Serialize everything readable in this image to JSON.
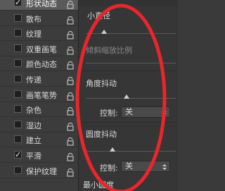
{
  "sidebar": {
    "items": [
      {
        "label": "形状动态",
        "checked": true,
        "active": true,
        "locked": true
      },
      {
        "label": "散布",
        "checked": false,
        "locked": true
      },
      {
        "label": "纹理",
        "checked": false,
        "locked": true
      },
      {
        "label": "双重画笔",
        "checked": false,
        "locked": true
      },
      {
        "label": "颜色动态",
        "checked": false,
        "locked": true
      },
      {
        "label": "传递",
        "checked": false,
        "locked": true
      },
      {
        "label": "画笔笔势",
        "checked": false,
        "locked": true
      },
      {
        "label": "杂色",
        "checked": false,
        "locked": true
      },
      {
        "label": "湿边",
        "checked": false,
        "locked": true
      },
      {
        "label": "建立",
        "checked": false,
        "locked": true
      },
      {
        "label": "平滑",
        "checked": true,
        "locked": true
      },
      {
        "label": "保护纹理",
        "checked": false,
        "locked": true
      }
    ]
  },
  "panel": {
    "min_diameter_label": "小直径",
    "tilt_scale_label": "倾斜缩放比例",
    "angle_jitter_label": "角度抖动",
    "angle_control_label": "控制:",
    "angle_control_value": "关",
    "roundness_jitter_label": "圆度抖动",
    "roundness_control_label": "控制:",
    "roundness_control_value": "关",
    "min_roundness_label": "最小圆度"
  },
  "annotation": {
    "color": "#e8262b"
  }
}
